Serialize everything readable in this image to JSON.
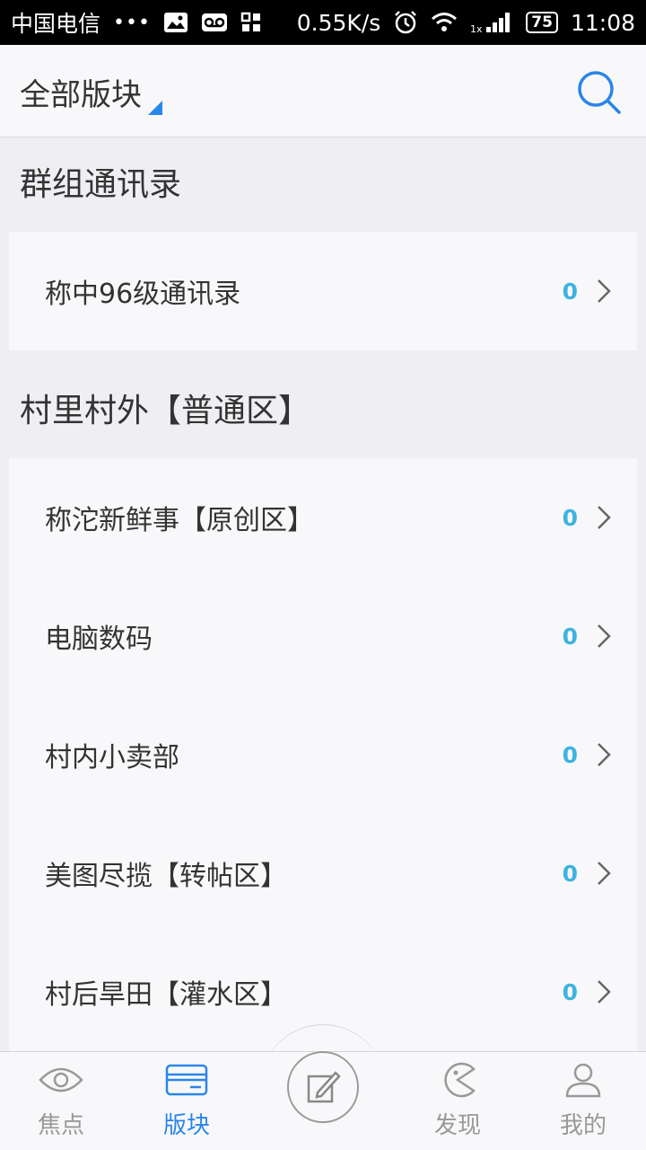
{
  "status_bar": {
    "carrier": "中国电信",
    "dots": "•••",
    "speed": "0.55K/s",
    "battery": "75",
    "time": "11:08",
    "icons": [
      "image-icon",
      "voicemail-icon",
      "grid-icon",
      "alarm-icon",
      "wifi-icon",
      "signal-icon"
    ]
  },
  "header": {
    "title": "全部版块",
    "search_icon": "search-icon",
    "accent_color": "#2a86e8"
  },
  "sections": [
    {
      "title": "群组通讯录",
      "items": [
        {
          "label": "称中96级通讯录",
          "count": "0"
        }
      ]
    },
    {
      "title": "村里村外【普通区】",
      "items": [
        {
          "label": "称沱新鲜事【原创区】",
          "count": "0"
        },
        {
          "label": "电脑数码",
          "count": "0"
        },
        {
          "label": "村内小卖部",
          "count": "0"
        },
        {
          "label": "美图尽揽【转帖区】",
          "count": "0"
        },
        {
          "label": "村后旱田【灌水区】",
          "count": "0"
        }
      ]
    }
  ],
  "bottom_nav": {
    "items": [
      {
        "label": "焦点",
        "icon": "eye-icon",
        "active": false
      },
      {
        "label": "版块",
        "icon": "card-icon",
        "active": true
      },
      {
        "label": "发现",
        "icon": "pacman-icon",
        "active": false
      },
      {
        "label": "我的",
        "icon": "user-icon",
        "active": false
      }
    ],
    "compose_icon": "compose-icon"
  },
  "colors": {
    "count": "#3fb3e0",
    "active": "#2a86e8",
    "inactive": "#999999"
  }
}
